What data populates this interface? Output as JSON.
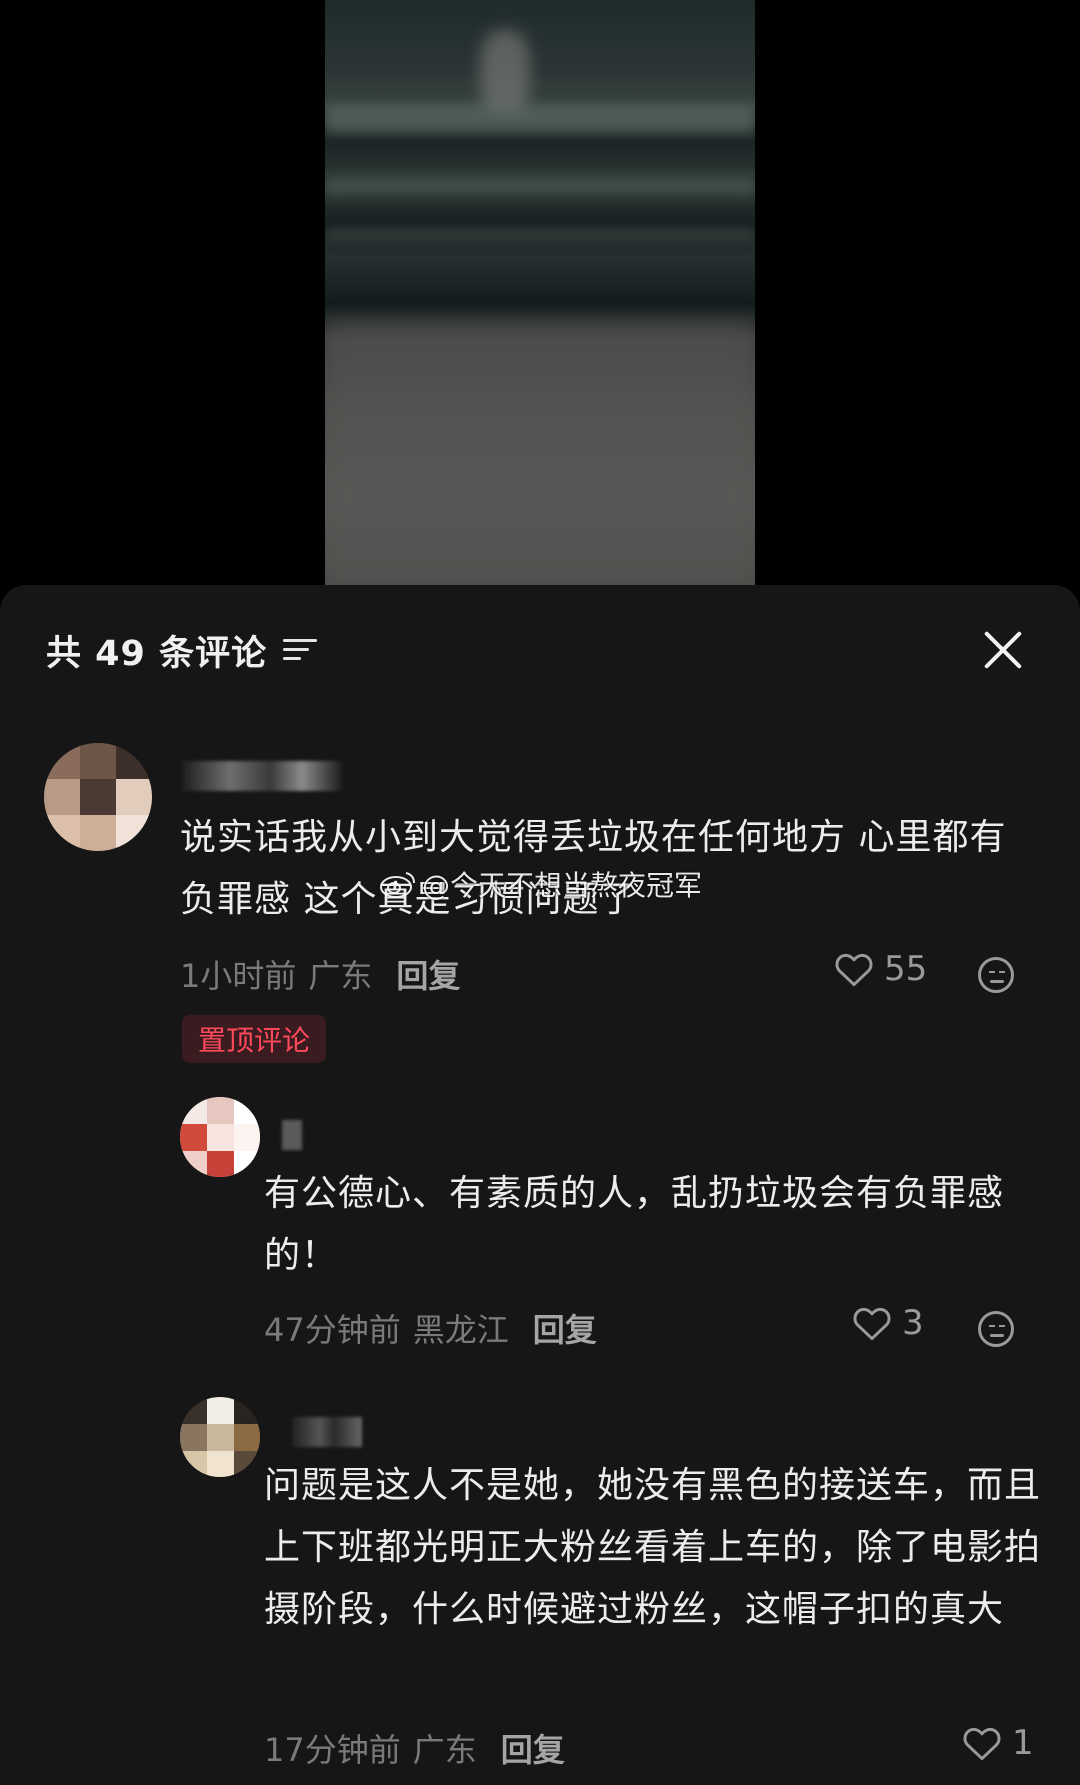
{
  "comments_panel": {
    "title": "共 49 条评论",
    "comments": [
      {
        "text": "说实话我从小到大觉得丢垃圾在任何地方 心里都有负罪感 这个真是习惯问题了",
        "time": "1小时前",
        "location": "广东",
        "reply_label": "回复",
        "likes": "55",
        "badge": "置顶评论"
      },
      {
        "text": "有公德心、有素质的人，乱扔垃圾会有负罪感的！",
        "time": "47分钟前",
        "location": "黑龙江",
        "reply_label": "回复",
        "likes": "3"
      },
      {
        "text": "问题是这人不是她，她没有黑色的接送车，而且上下班都光明正大粉丝看着上车的，除了电影拍摄阶段，什么时候避过粉丝，这帽子扣的真大",
        "time": "17分钟前",
        "location": "广东",
        "reply_label": "回复",
        "likes": "1"
      }
    ]
  },
  "watermark": "@今天不想当熬夜冠军",
  "colors": {
    "sheet_bg": "#161616",
    "badge_text": "#ff4a5c",
    "badge_bg": "#3a1b1f",
    "meta_text": "#7a7a7a"
  },
  "icons": [
    "filter-icon",
    "close-icon",
    "heart-icon",
    "dislike-icon",
    "weibo-icon"
  ]
}
